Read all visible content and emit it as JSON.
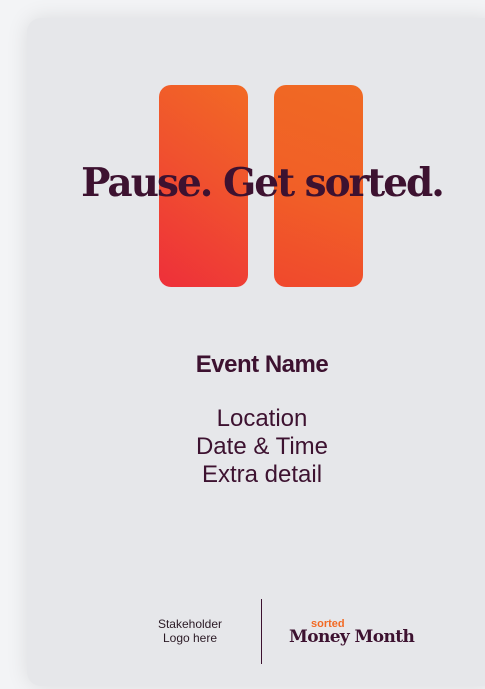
{
  "poster": {
    "headline": "Pause. Get sorted.",
    "event_name": "Event Name",
    "details": [
      "Location",
      "Date & Time",
      "Extra detail"
    ],
    "stakeholder_logo": [
      "Stakeholder",
      "Logo here"
    ],
    "brand": {
      "tag": "sorted",
      "name": "Money Month"
    }
  },
  "colors": {
    "background": "#e6e7ea",
    "text": "#3d1230",
    "accent_orange": "#f26a24",
    "accent_red": "#ee2f3a"
  },
  "icons": [
    "pause-icon"
  ]
}
